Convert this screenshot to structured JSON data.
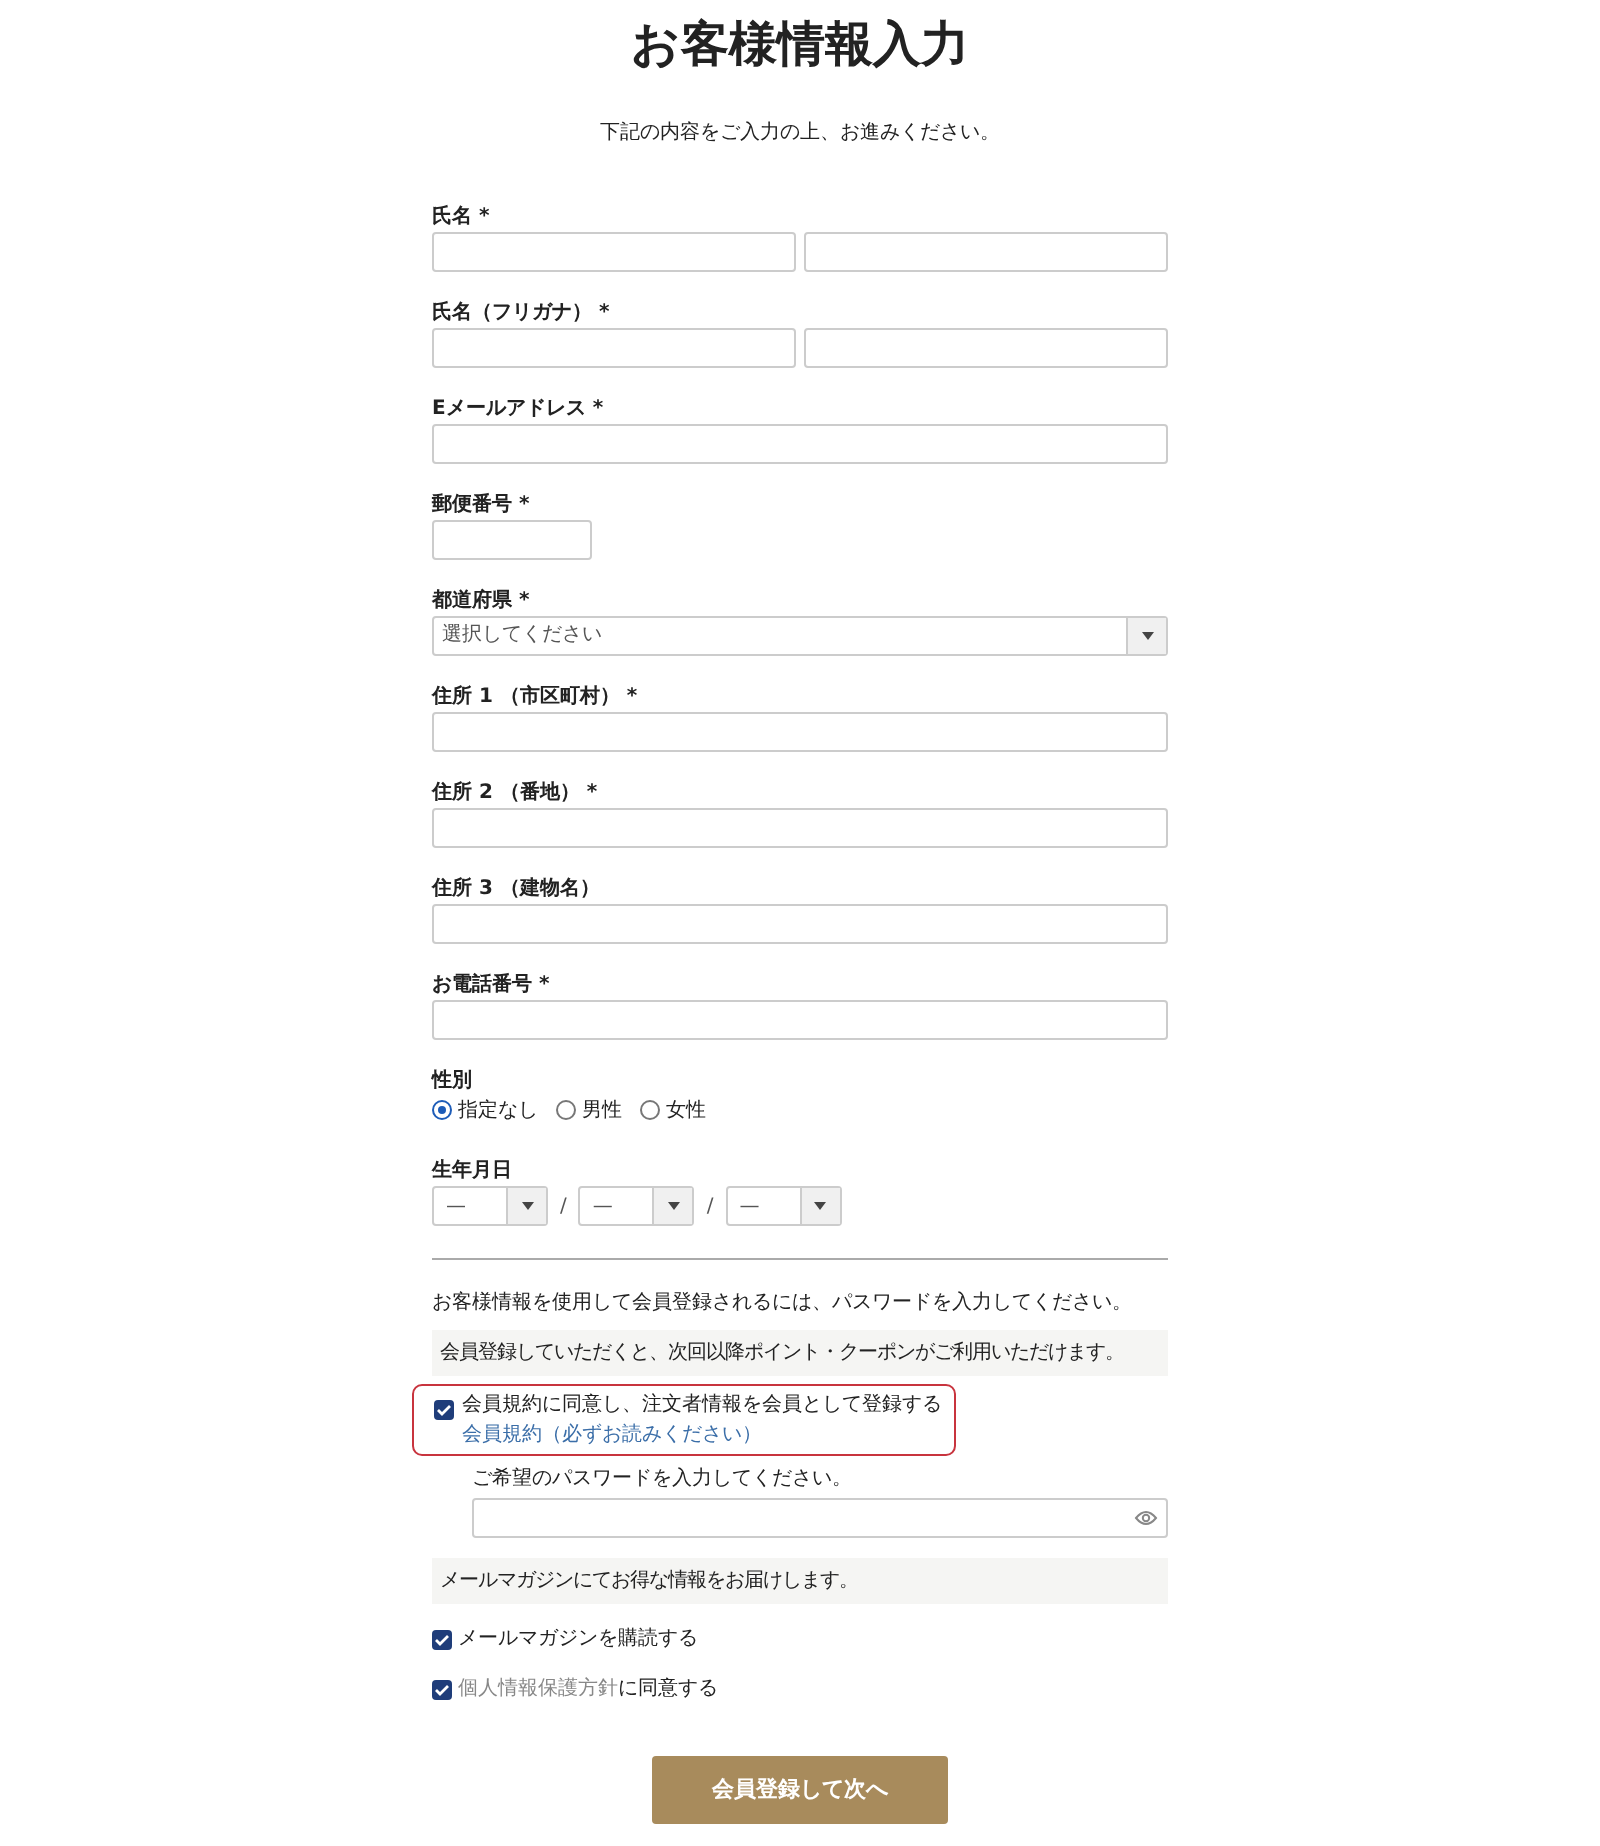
{
  "title": "お客様情報入力",
  "intro": "下記の内容をご入力の上、お進みください。",
  "fields": [
    {
      "kind": "pair",
      "label": "氏名 *"
    },
    {
      "kind": "pair",
      "label": "氏名（フリガナ） *"
    },
    {
      "kind": "text",
      "label": "Eメールアドレス *"
    },
    {
      "kind": "short",
      "label": "郵便番号 *"
    },
    {
      "kind": "select",
      "label": "都道府県 *",
      "placeholder": "選択してください"
    },
    {
      "kind": "text",
      "label": "住所 1 （市区町村） *"
    },
    {
      "kind": "text",
      "label": "住所 2 （番地） *"
    },
    {
      "kind": "text",
      "label": "住所 3 （建物名）"
    },
    {
      "kind": "text",
      "label": "お電話番号 *"
    },
    {
      "kind": "radio",
      "label": "性別",
      "options": [
        {
          "label": "指定なし",
          "selected": true
        },
        {
          "label": "男性",
          "selected": false
        },
        {
          "label": "女性",
          "selected": false
        }
      ]
    },
    {
      "kind": "date",
      "label": "生年月日",
      "parts": [
        {
          "value": "—"
        },
        {
          "separator": "/",
          "value": "—"
        },
        {
          "separator": "/",
          "value": "—"
        }
      ]
    }
  ],
  "membership": {
    "notice": "お客様情報を使用して会員登録されるには、パスワードを入力してください。",
    "benefit": "会員登録していただくと、次回以降ポイント・クーポンがご利用いただけます。",
    "agree": {
      "checked": true,
      "highlighted": true,
      "label": "会員規約に同意し、注文者情報を会員として登録する",
      "link": "会員規約（必ずお読みください）"
    },
    "password_label": "ご希望のパスワードを入力してください。",
    "newsletter_info": "メールマガジンにてお得な情報をお届けします。",
    "checkboxes": [
      {
        "checked": true,
        "label": "メールマガジンを購読する"
      },
      {
        "checked": true,
        "link": "個人情報保護方針",
        "label": "に同意する"
      }
    ]
  },
  "submit": "会員登録して次へ"
}
